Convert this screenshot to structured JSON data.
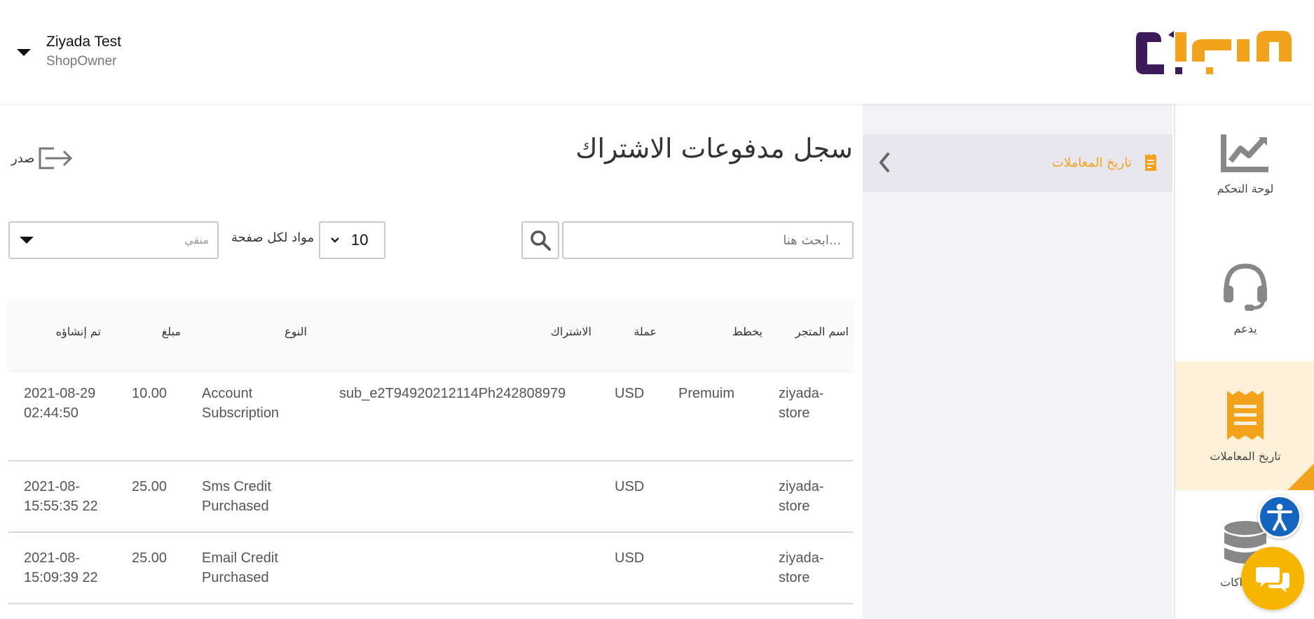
{
  "header": {
    "user_name": "Ziyada Test",
    "user_role": "ShopOwner",
    "brand_color": "#f3a31b",
    "brand_dark": "#3d1a5a"
  },
  "rail": {
    "items": [
      {
        "label": "لوحة التحكم",
        "icon": "chart-icon"
      },
      {
        "label": "يدعم",
        "icon": "headset-icon"
      },
      {
        "label": "تاريخ المعاملات",
        "icon": "receipt-icon",
        "active": true
      },
      {
        "label": "اكات",
        "icon": "database-icon"
      }
    ]
  },
  "subpanel": {
    "active_label": "تاريخ المعاملات"
  },
  "main": {
    "title": "سجل مدفوعات الاشتراك",
    "export_label": "صدر",
    "search_placeholder": "...ابحث هنا",
    "per_page_value": "10",
    "per_page_label": "مواد لكل صفحة",
    "filter_placeholder": "منقي"
  },
  "table": {
    "headers": {
      "created": "تم إنشاؤه",
      "amount": "مبلغ",
      "type": "النوع",
      "subscription": "الاشتراك",
      "currency": "عملة",
      "plan": "يخطط",
      "store": "اسم المتجر"
    },
    "rows": [
      {
        "created": "2021-08-29 02:44:50",
        "amount": "10.00",
        "type": "Account Subscription",
        "subscription": "sub_e2T94920212114Ph242808979",
        "currency": "USD",
        "plan": "Premuim",
        "store": "ziyada-store"
      },
      {
        "created": "2021-08-15:55:35 22",
        "amount": "25.00",
        "type": "Sms Credit Purchased",
        "subscription": "",
        "currency": "USD",
        "plan": "",
        "store": "ziyada-store"
      },
      {
        "created": "2021-08-15:09:39 22",
        "amount": "25.00",
        "type": "Email Credit Purchased",
        "subscription": "",
        "currency": "USD",
        "plan": "",
        "store": "ziyada-store"
      }
    ]
  }
}
